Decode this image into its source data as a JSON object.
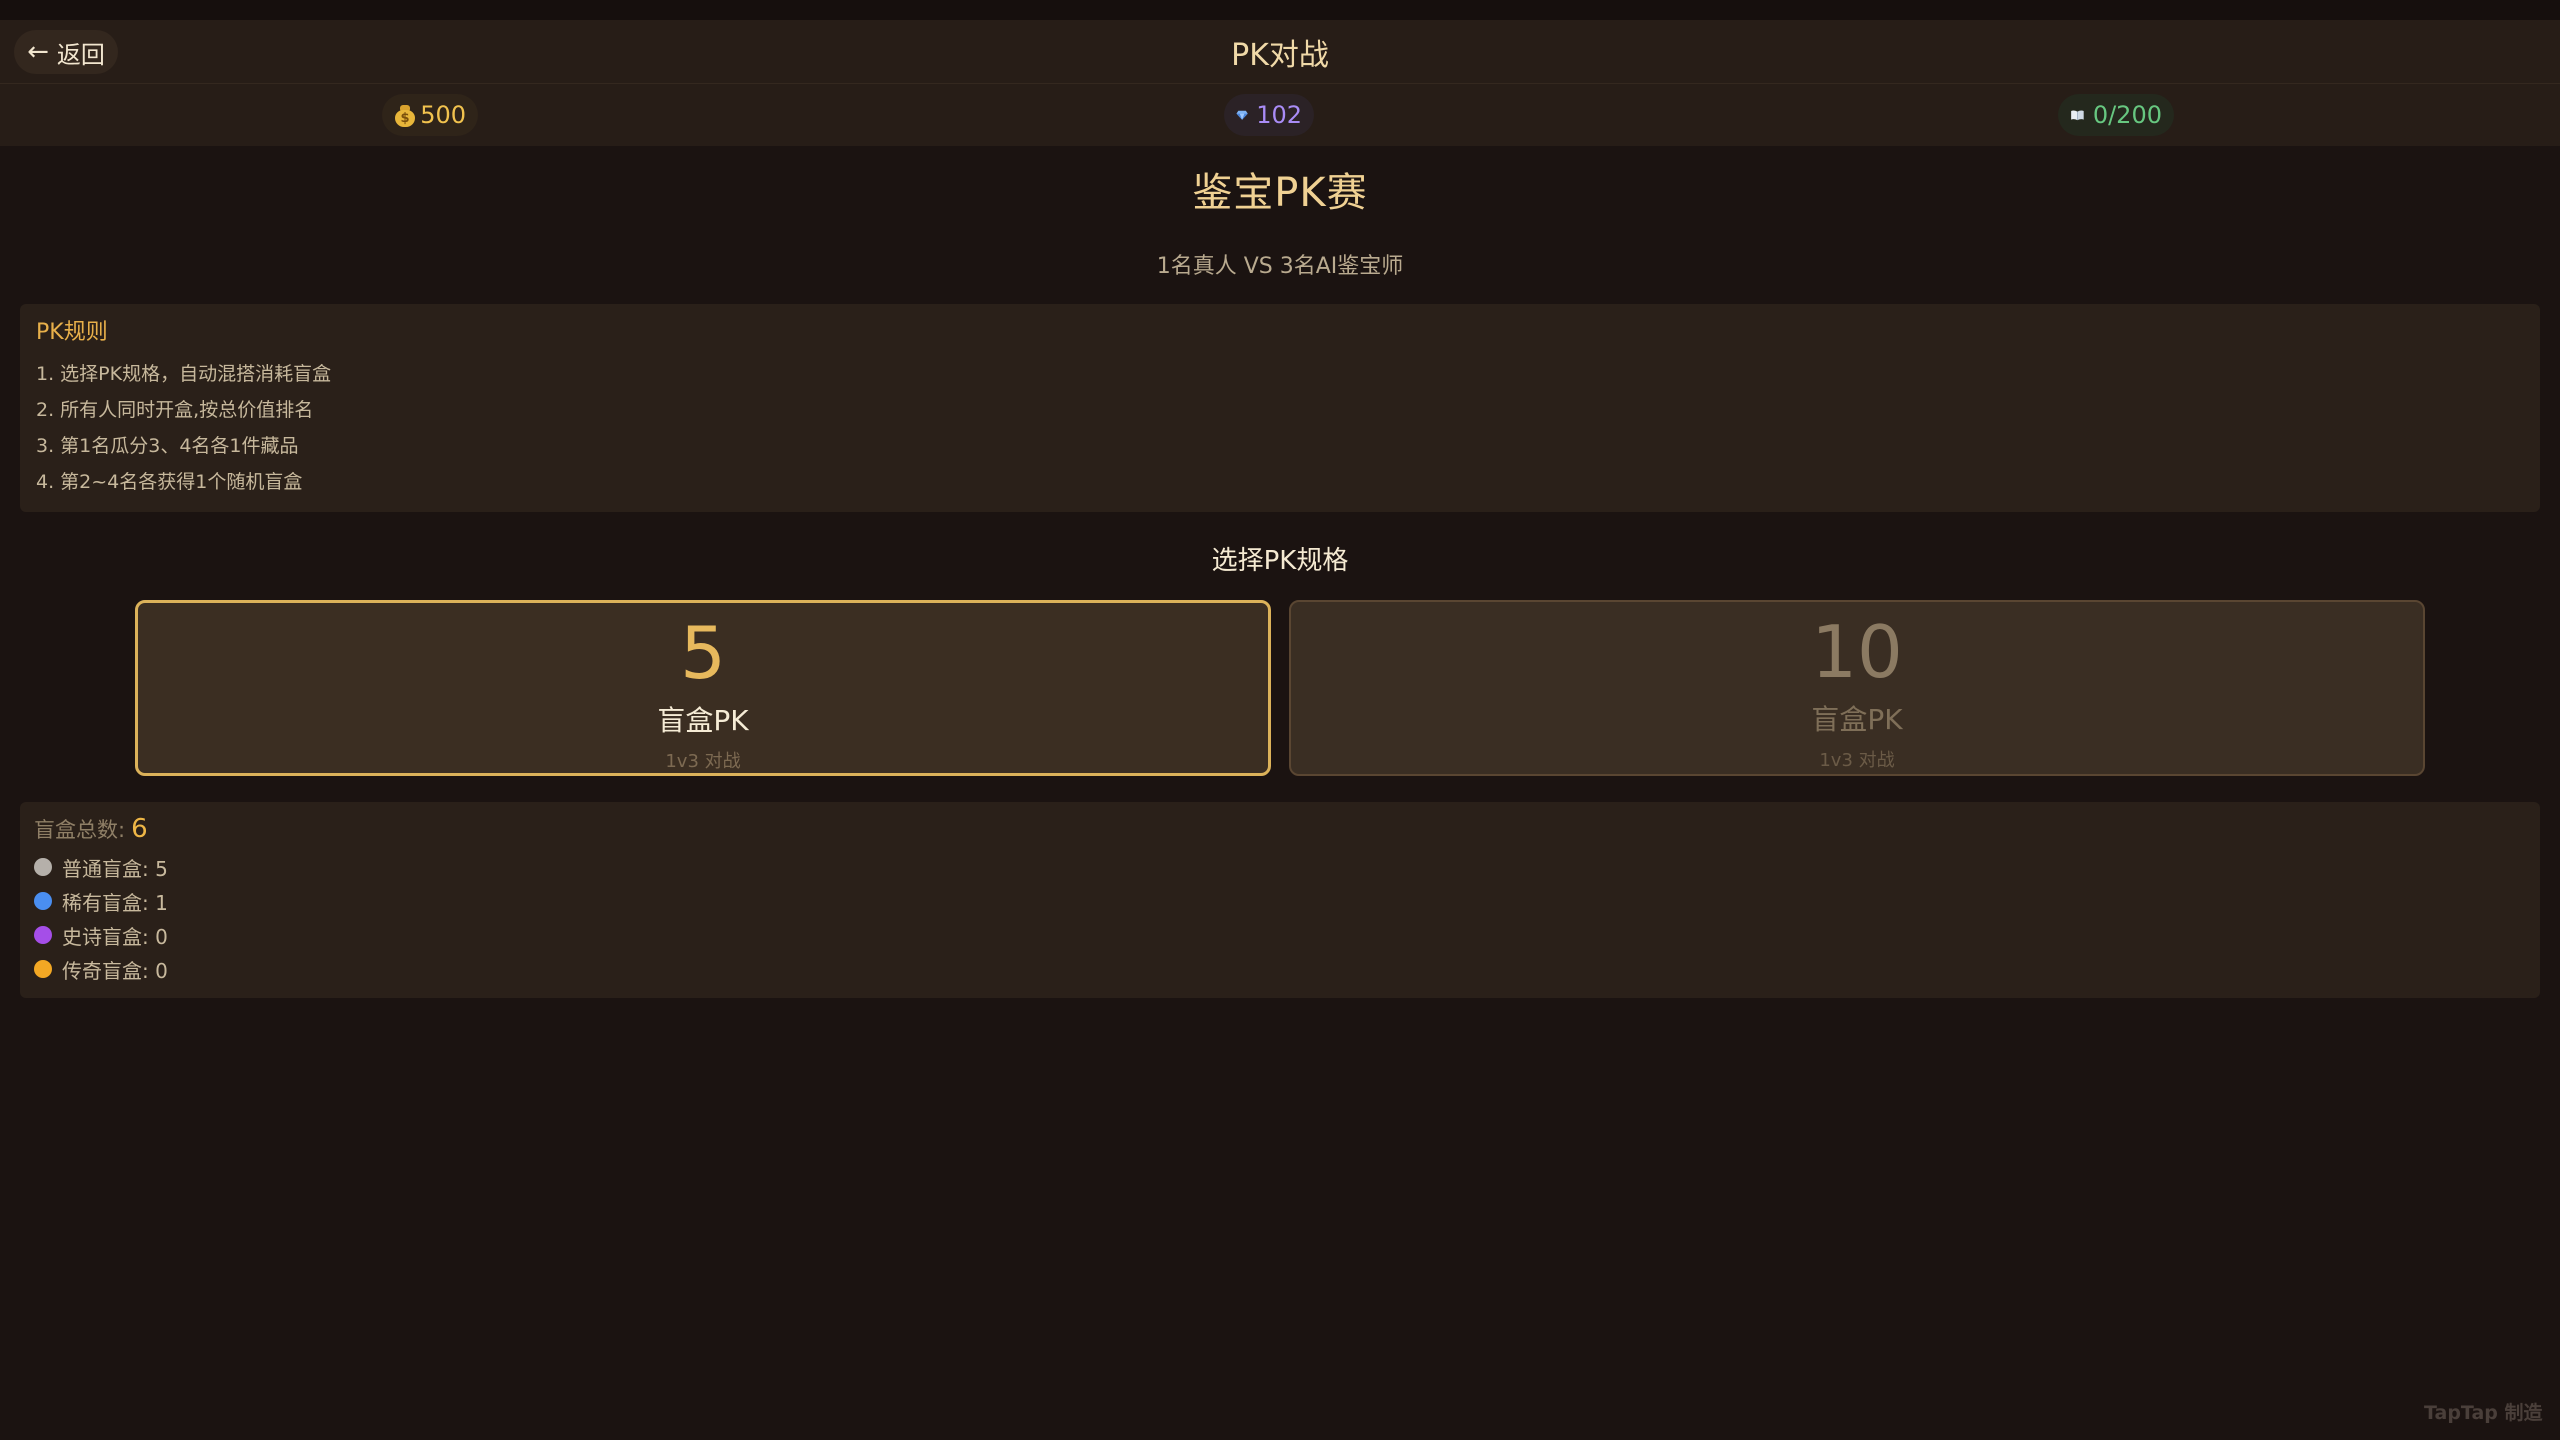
{
  "header": {
    "back_label": "返回",
    "title": "PK对战"
  },
  "currency": {
    "gold": "500",
    "gems": "102",
    "collection": "0/200"
  },
  "hero": {
    "title": "鉴宝PK赛",
    "subtitle": "1名真人 VS 3名AI鉴宝师"
  },
  "rules": {
    "title": "PK规则",
    "lines": [
      "1. 选择PK规格，自动混搭消耗盲盒",
      "2. 所有人同时开盒,按总价值排名",
      "3. 第1名瓜分3、4名各1件藏品",
      "4. 第2~4名各获得1个随机盲盒"
    ]
  },
  "selection": {
    "title": "选择PK规格",
    "options": [
      {
        "count": "5",
        "name": "盲盒PK",
        "mode": "1v3 对战",
        "selected": true
      },
      {
        "count": "10",
        "name": "盲盒PK",
        "mode": "1v3 对战",
        "selected": false
      }
    ]
  },
  "summary": {
    "total_label": "盲盒总数:",
    "total_value": "6",
    "types": [
      {
        "label": "普通盲盒: 5",
        "color": "#b5b0aa"
      },
      {
        "label": "稀有盲盒: 1",
        "color": "#4a8ef0"
      },
      {
        "label": "史诗盲盒: 0",
        "color": "#a54ee8"
      },
      {
        "label": "传奇盲盒: 0",
        "color": "#f3a824"
      }
    ]
  },
  "watermark": "TapTap 制造"
}
